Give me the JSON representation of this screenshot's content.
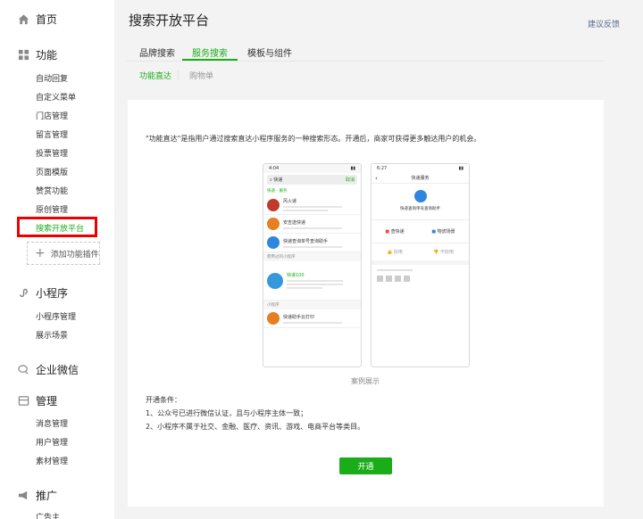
{
  "sidebar": {
    "home_label": "首页",
    "function": {
      "label": "功能",
      "items": [
        "自动回复",
        "自定义菜单",
        "门店管理",
        "留言管理",
        "投票管理",
        "页面模版",
        "赞赏功能",
        "原创管理",
        "搜索开放平台"
      ],
      "add_plugin_label": "添加功能插件"
    },
    "miniprogram": {
      "label": "小程序",
      "items": [
        "小程序管理",
        "展示场景"
      ]
    },
    "wework_label": "企业微信",
    "manage": {
      "label": "管理",
      "items": [
        "消息管理",
        "用户管理",
        "素材管理"
      ]
    },
    "promote": {
      "label": "推广",
      "items": [
        "广告主"
      ]
    }
  },
  "header": {
    "title": "搜索开放平台",
    "feedback_label": "建议反馈"
  },
  "tabs": [
    "品牌搜索",
    "服务搜索",
    "模板与组件"
  ],
  "subtabs": [
    "功能直达",
    "购物单"
  ],
  "content": {
    "intro": "\"功能直达\"是指用户通过搜索直达小程序服务的一种搜索形态。开通后，商家可获得更多触达用户的机会。",
    "caption": "案例展示",
    "conditions_title": "开通条件：",
    "conditions": [
      "1、公众号已进行微信认证，且与小程序主体一致；",
      "2、小程序不属于社交、金融、医疗、资讯、游戏、电商平台等类目。"
    ],
    "open_button": "开通"
  },
  "mock_left": {
    "time": "4:04",
    "search_text": "快递",
    "search_action": "取消",
    "section_label": "快递 - 服务",
    "rows": [
      {
        "name": "风火递",
        "color": "#c0392b"
      },
      {
        "name": "安吉送快递",
        "color": "#e67e22"
      },
      {
        "name": "快递查询单号查询助手",
        "color": "#2e86de"
      }
    ],
    "used_label": "使用过的小程序",
    "used_name": "快递100",
    "mini_label": "小程序",
    "mini_name": "快递助手云打印"
  },
  "mock_right": {
    "time": "6:27",
    "title": "快递服务",
    "app_name": "快递查询单号查询助手",
    "opt1": "查快递",
    "opt2": "物流场景",
    "like_label": "好用",
    "dislike_label": "不好用"
  }
}
